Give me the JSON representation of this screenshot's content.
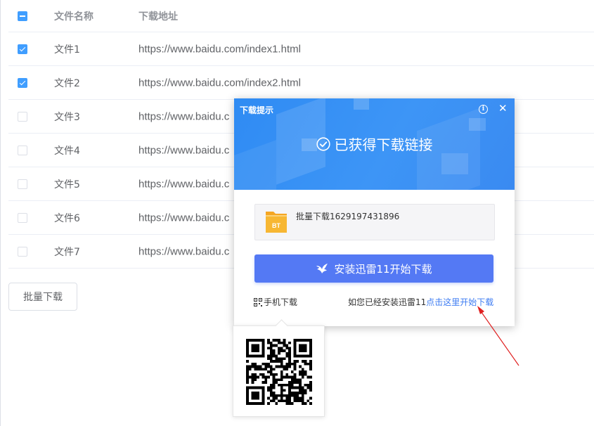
{
  "table": {
    "header": {
      "name": "文件名称",
      "url": "下载地址"
    },
    "rows": [
      {
        "name": "文件1",
        "url": "https://www.baidu.com/index1.html",
        "checked": true
      },
      {
        "name": "文件2",
        "url": "https://www.baidu.com/index2.html",
        "checked": true
      },
      {
        "name": "文件3",
        "url": "https://www.baidu.c",
        "checked": false
      },
      {
        "name": "文件4",
        "url": "https://www.baidu.c",
        "checked": false
      },
      {
        "name": "文件5",
        "url": "https://www.baidu.c",
        "checked": false
      },
      {
        "name": "文件6",
        "url": "https://www.baidu.c",
        "checked": false
      },
      {
        "name": "文件7",
        "url": "https://www.baidu.c",
        "checked": false
      }
    ]
  },
  "batch_button": "批量下载",
  "dialog": {
    "title": "下载提示",
    "headline": "已获得下载链接",
    "file_label": "批量下载1629197431896",
    "file_icon": "bt-folder-icon",
    "install_button": "安装迅雷11开始下载",
    "mobile_download": "手机下载",
    "installed_hint": "如您已经安装迅雷11",
    "installed_link": "点击这里开始下载",
    "colors": {
      "header": "#3a8ff4",
      "primary": "#5479f4",
      "link": "#3e7cf2",
      "checkbox": "#409eff"
    }
  }
}
